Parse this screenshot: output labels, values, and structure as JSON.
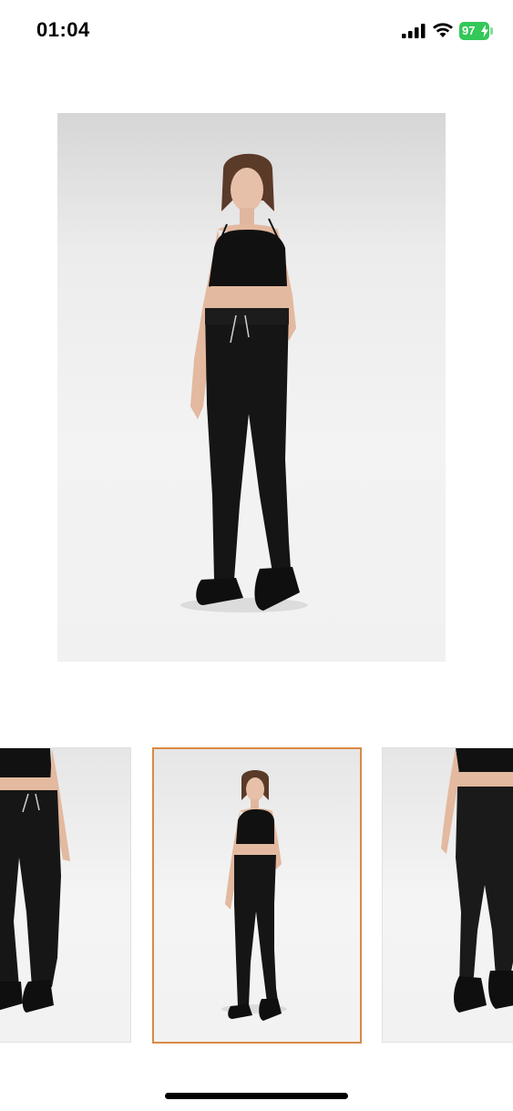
{
  "status_bar": {
    "time": "01:04",
    "battery_level": "97",
    "battery_color": "#34c759",
    "icons": [
      "signal-icon",
      "wifi-icon",
      "battery-icon"
    ]
  },
  "main_image": {
    "subject": "product-photo-full-body-front"
  },
  "thumbnails": {
    "items": [
      {
        "view": "front-closeup"
      },
      {
        "view": "full-body-front",
        "selected": true
      },
      {
        "view": "back-closeup"
      }
    ],
    "selected_border_color": "#d98a45"
  }
}
